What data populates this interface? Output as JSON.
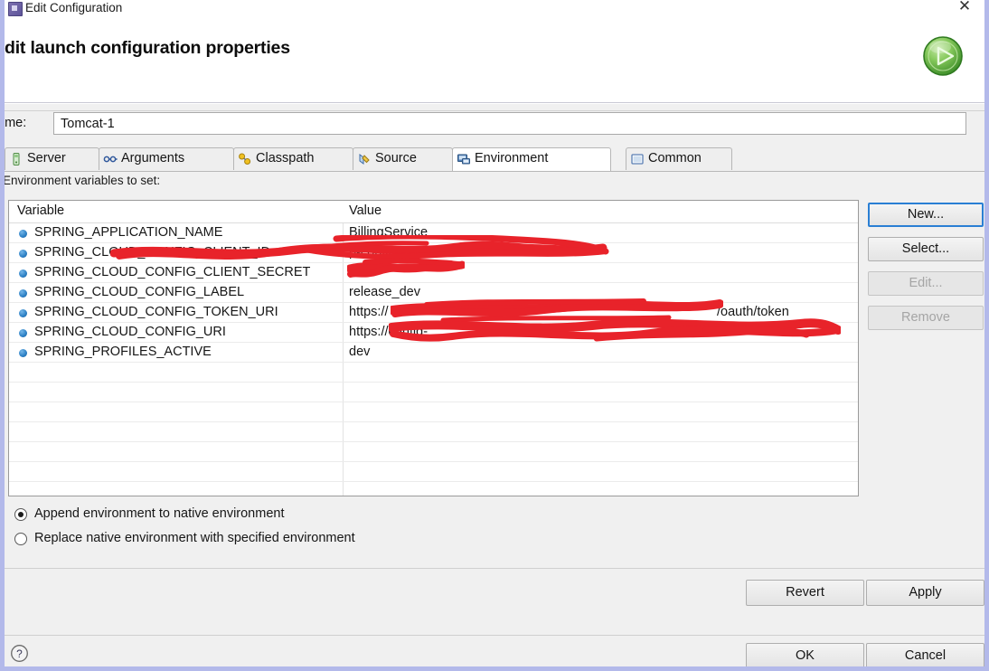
{
  "window": {
    "title": "Edit Configuration",
    "icon": "app-icon",
    "close_label": "✕"
  },
  "banner": {
    "heading": "dit launch configuration properties",
    "run_icon": "green-play-icon"
  },
  "name_field": {
    "label": "ame:",
    "value": "Tomcat-1",
    "placeholder": ""
  },
  "tabs": [
    {
      "label": "Server",
      "icon": "server-icon",
      "active": false
    },
    {
      "label": "Arguments",
      "icon": "arguments-icon",
      "active": false
    },
    {
      "label": "Classpath",
      "icon": "classpath-icon",
      "active": false
    },
    {
      "label": "Source",
      "icon": "source-icon",
      "active": false
    },
    {
      "label": "Environment",
      "icon": "environment-icon",
      "active": true
    },
    {
      "label": "Common",
      "icon": "common-icon",
      "active": false
    }
  ],
  "section": {
    "label": "Environment variables to set:"
  },
  "table": {
    "columns": [
      "Variable",
      "Value"
    ],
    "rows": [
      {
        "variable": "SPRING_APPLICATION_NAME",
        "value": "BillingService",
        "redacted": "none"
      },
      {
        "variable": "SPRING_CLOUD_CONFIG_CLIENT_ID",
        "value": "p-config-server-",
        "redacted": "partial"
      },
      {
        "variable": "SPRING_CLOUD_CONFIG_CLIENT_SECRET",
        "value": "",
        "redacted": "full"
      },
      {
        "variable": "SPRING_CLOUD_CONFIG_LABEL",
        "value": "release_dev",
        "redacted": "none"
      },
      {
        "variable": "SPRING_CLOUD_CONFIG_TOKEN_URI",
        "value": "https://",
        "redacted": "partial",
        "value_tail": "/oauth/token"
      },
      {
        "variable": "SPRING_CLOUD_CONFIG_URI",
        "value": "https://config-",
        "redacted": "partial"
      },
      {
        "variable": "SPRING_PROFILES_ACTIVE",
        "value": "dev",
        "redacted": "none"
      }
    ],
    "empty_row_count": 6
  },
  "side_buttons": [
    {
      "label": "New...",
      "state": "focused"
    },
    {
      "label": "Select...",
      "state": "normal"
    },
    {
      "label": "Edit...",
      "state": "disabled"
    },
    {
      "label": "Remove",
      "state": "disabled"
    }
  ],
  "radio_options": [
    {
      "label": "Append environment to native environment",
      "selected": true
    },
    {
      "label": "Replace native environment with specified environment",
      "selected": false
    }
  ],
  "bottom_buttons": {
    "revert": "Revert",
    "apply": "Apply",
    "ok": "OK",
    "cancel": "Cancel"
  },
  "help": {
    "icon": "help-question-icon"
  },
  "colors": {
    "dialog_border": "#b3b9ea",
    "redaction_red": "#e8232a",
    "focus_blue": "#2a7fd4",
    "bullet_blue": "#2b7fc4",
    "run_green": "#57b039"
  }
}
